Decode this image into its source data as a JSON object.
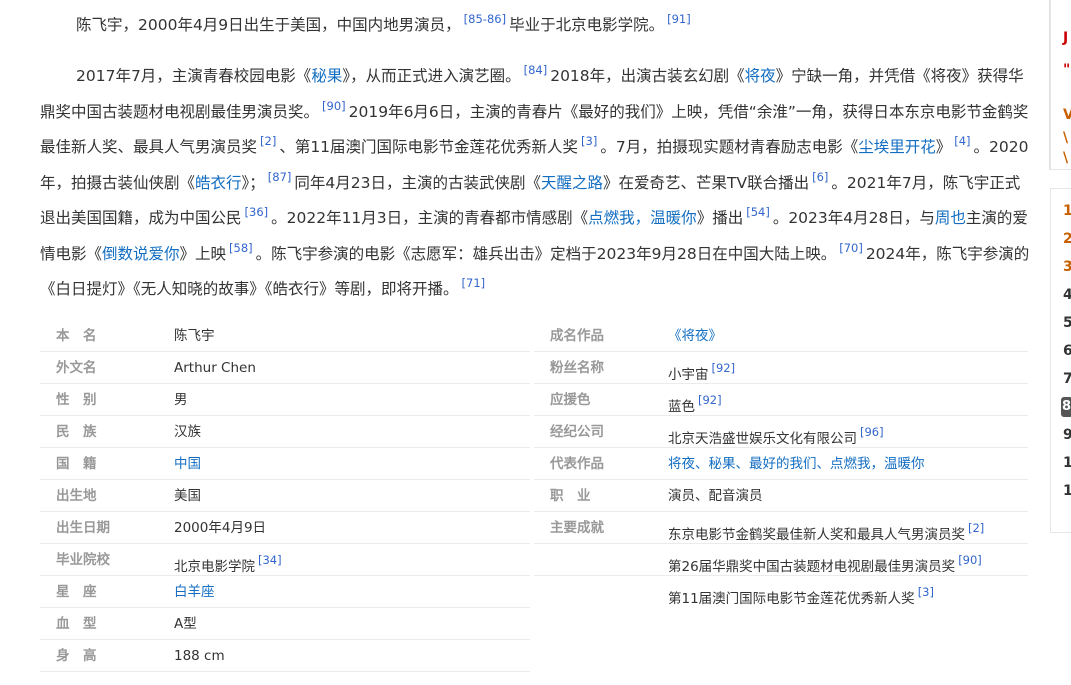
{
  "para1": {
    "text_a": "陈飞宇，2000年4月9日出生于美国，中国内地男演员，",
    "ref_a": "[85-86]",
    "text_b": "毕业于北京电影学院。",
    "ref_b": "[91]"
  },
  "para2": {
    "s01": "2017年7月，主演青春校园电影《",
    "l01": "秘果",
    "s02": "》，从而正式进入演艺圈。",
    "r01": "[84]",
    "s03": "2018年，出演古装玄幻剧《",
    "l02": "将夜",
    "s04": "》宁缺一角，并凭借《将夜》获得华鼎奖中国古装题材电视剧最佳男演员奖。",
    "r02": "[90]",
    "s05": "2019年6月6日，主演的青春片《最好的我们》上映，凭借“余淮”一角，获得日本东京电影节金鹤奖最佳新人奖、最具人气男演员奖",
    "r03": "[2]",
    "s06": "、第11届澳门国际电影节金莲花优秀新人奖",
    "r04": "[3]",
    "s07": "。7月，拍摄现实题材青春励志电影《",
    "l03": "尘埃里开花",
    "s08": "》",
    "r05": "[4]",
    "s09": "。2020年，拍摄古装仙侠剧《",
    "l04": "皓衣行",
    "s10": "》；",
    "r06": "[87]",
    "s11": "同年4月23日，主演的古装武侠剧《",
    "l05": "天醒之路",
    "s12": "》在爱奇艺、芒果TV联合播出",
    "r07": "[6]",
    "s13": "。2021年7月，陈飞宇正式退出美国国籍，成为中国公民",
    "r08": "[36]",
    "s14": "。2022年11月3日，主演的青春都市情感剧《",
    "l06": "点燃我，温暖你",
    "s15": "》播出",
    "r09": "[54]",
    "s16": "。2023年4月28日，与",
    "l07": "周也",
    "s17": "主演的爱情电影《",
    "l08": "倒数说爱你",
    "s18": "》上映",
    "r10": "[58]",
    "s19": "。陈飞宇参演的电影《志愿军：雄兵出击》定档于2023年9月28日在中国大陆上映。",
    "r11": "[70]",
    "s20": "2024年，陈飞宇参演的《白日提灯》《无人知晓的故事》《皓衣行》等剧，即将开播。",
    "r12": "[71]"
  },
  "info_left": [
    {
      "label": "本　名",
      "value": "陈飞宇",
      "ref": ""
    },
    {
      "label": "外文名",
      "value": "Arthur Chen",
      "ref": ""
    },
    {
      "label": "性　别",
      "value": "男",
      "ref": ""
    },
    {
      "label": "民　族",
      "value": "汉族",
      "ref": ""
    },
    {
      "label": "国　籍",
      "value": "中国",
      "ref": ""
    },
    {
      "label": "出生地",
      "value": "美国",
      "ref": ""
    },
    {
      "label": "出生日期",
      "value": "2000年4月9日",
      "ref": ""
    },
    {
      "label": "毕业院校",
      "value": "北京电影学院",
      "ref": "[34]"
    },
    {
      "label": "星　座",
      "value": "白羊座",
      "ref": ""
    },
    {
      "label": "血　型",
      "value": "A型",
      "ref": ""
    },
    {
      "label": "身　高",
      "value": "188 cm",
      "ref": ""
    }
  ],
  "info_right": [
    {
      "label": "成名作品",
      "value": "《将夜》",
      "ref": ""
    },
    {
      "label": "粉丝名称",
      "value": "小宇宙",
      "ref": "[92]"
    },
    {
      "label": "应援色",
      "value": "蓝色",
      "ref": "[92]"
    },
    {
      "label": "经纪公司",
      "value": "北京天浩盛世娱乐文化有限公司",
      "ref": "[96]"
    },
    {
      "label": "代表作品",
      "value": "将夜、秘果、最好的我们、点燃我，温暖你",
      "ref": ""
    },
    {
      "label": "职　业",
      "value": "演员、配音演员",
      "ref": ""
    },
    {
      "label": "主要成就",
      "value": "东京电影节金鹤奖最佳新人奖和最具人气男演员奖",
      "ref": "[2]"
    },
    {
      "label": "",
      "value": "第26届华鼎奖中国古装题材电视剧最佳男演员奖",
      "ref": "[90]"
    },
    {
      "label": "",
      "value": "第11届澳门国际电影节金莲花优秀新人奖",
      "ref": "[3]"
    }
  ],
  "sidebar": {
    "top_chars": [
      "J",
      "\"",
      "V",
      "\\",
      "\\"
    ],
    "toc_numbers": [
      "1",
      "2",
      "3",
      "4",
      "5",
      "6",
      "7",
      "8",
      "9",
      "1",
      "1"
    ]
  },
  "colors": {
    "link": "#136ec2",
    "ref": "#3366cc",
    "label": "#999999"
  }
}
